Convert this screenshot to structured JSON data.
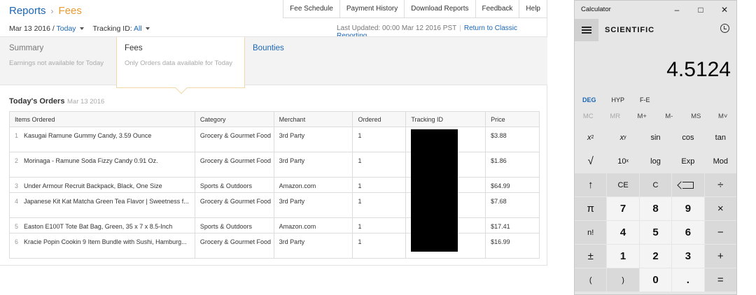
{
  "reports": {
    "breadcrumb": {
      "root": "Reports",
      "separator": "›",
      "current": "Fees"
    },
    "top_links": [
      "Fee Schedule",
      "Payment History",
      "Download Reports",
      "Feedback",
      "Help"
    ],
    "filters": {
      "date_prefix": "Mar 13 2016 /",
      "date_value": "Today",
      "tracking_label": "Tracking ID:",
      "tracking_value": "All"
    },
    "last_updated": "Last Updated: 00:00 Mar 12 2016 PST",
    "return_link": "Return to Classic Reporting",
    "tabs": [
      {
        "title": "Summary",
        "subtitle": "Earnings not available for Today"
      },
      {
        "title": "Fees",
        "subtitle": "Only Orders data available for Today"
      },
      {
        "title": "Bounties",
        "subtitle": ""
      }
    ],
    "orders": {
      "title": "Today's Orders",
      "date": "Mar 13 2016",
      "columns": [
        "Items Ordered",
        "Category",
        "Merchant",
        "Ordered",
        "Tracking ID",
        "Price"
      ],
      "rows": [
        {
          "n": "1",
          "item": "Kasugai Ramune Gummy Candy, 3.59 Ounce",
          "category": "Grocery & Gourmet Food",
          "merchant": "3rd Party",
          "ordered": "1",
          "price": "$3.88"
        },
        {
          "n": "2",
          "item": "Morinaga - Ramune Soda Fizzy Candy 0.91 Oz.",
          "category": "Grocery & Gourmet Food",
          "merchant": "3rd Party",
          "ordered": "1",
          "price": "$1.86"
        },
        {
          "n": "3",
          "item": "Under Armour Recruit Backpack, Black, One Size",
          "category": "Sports & Outdoors",
          "merchant": "Amazon.com",
          "ordered": "1",
          "price": "$64.99"
        },
        {
          "n": "4",
          "item": "Japanese Kit Kat Matcha Green Tea Flavor | Sweetness f...",
          "category": "Grocery & Gourmet Food",
          "merchant": "3rd Party",
          "ordered": "1",
          "price": "$7.68"
        },
        {
          "n": "5",
          "item": "Easton E100T Tote Bat Bag, Green, 35 x 7 x 8.5-Inch",
          "category": "Sports & Outdoors",
          "merchant": "Amazon.com",
          "ordered": "1",
          "price": "$17.41"
        },
        {
          "n": "6",
          "item": "Kracie Popin Cookin 9 Item Bundle with Sushi, Hamburg...",
          "category": "Grocery & Gourmet Food",
          "merchant": "3rd Party",
          "ordered": "1",
          "price": "$16.99"
        }
      ]
    }
  },
  "calculator": {
    "window_title": "Calculator",
    "mode": "SCIENTIFIC",
    "display": "4.5124",
    "angle_modes": [
      "DEG",
      "HYP",
      "F-E"
    ],
    "memory": [
      "MC",
      "MR",
      "M+",
      "M-",
      "MS",
      "M˅"
    ],
    "keys": {
      "x2": "x",
      "xy": "x",
      "sin": "sin",
      "cos": "cos",
      "tan": "tan",
      "sqrt": "√",
      "ten": "10",
      "log": "log",
      "exp": "Exp",
      "mod": "Mod",
      "up": "↑",
      "ce": "CE",
      "c": "C",
      "div": "÷",
      "pi": "π",
      "d7": "7",
      "d8": "8",
      "d9": "9",
      "mul": "×",
      "fact": "n!",
      "d4": "4",
      "d5": "5",
      "d6": "6",
      "minus": "−",
      "pm": "±",
      "d1": "1",
      "d2": "2",
      "d3": "3",
      "plus": "+",
      "lp": "(",
      "rp": ")",
      "d0": "0",
      "dot": ".",
      "eq": "="
    },
    "superscripts": {
      "x2": "2",
      "xy": "y",
      "ten": "x"
    }
  }
}
